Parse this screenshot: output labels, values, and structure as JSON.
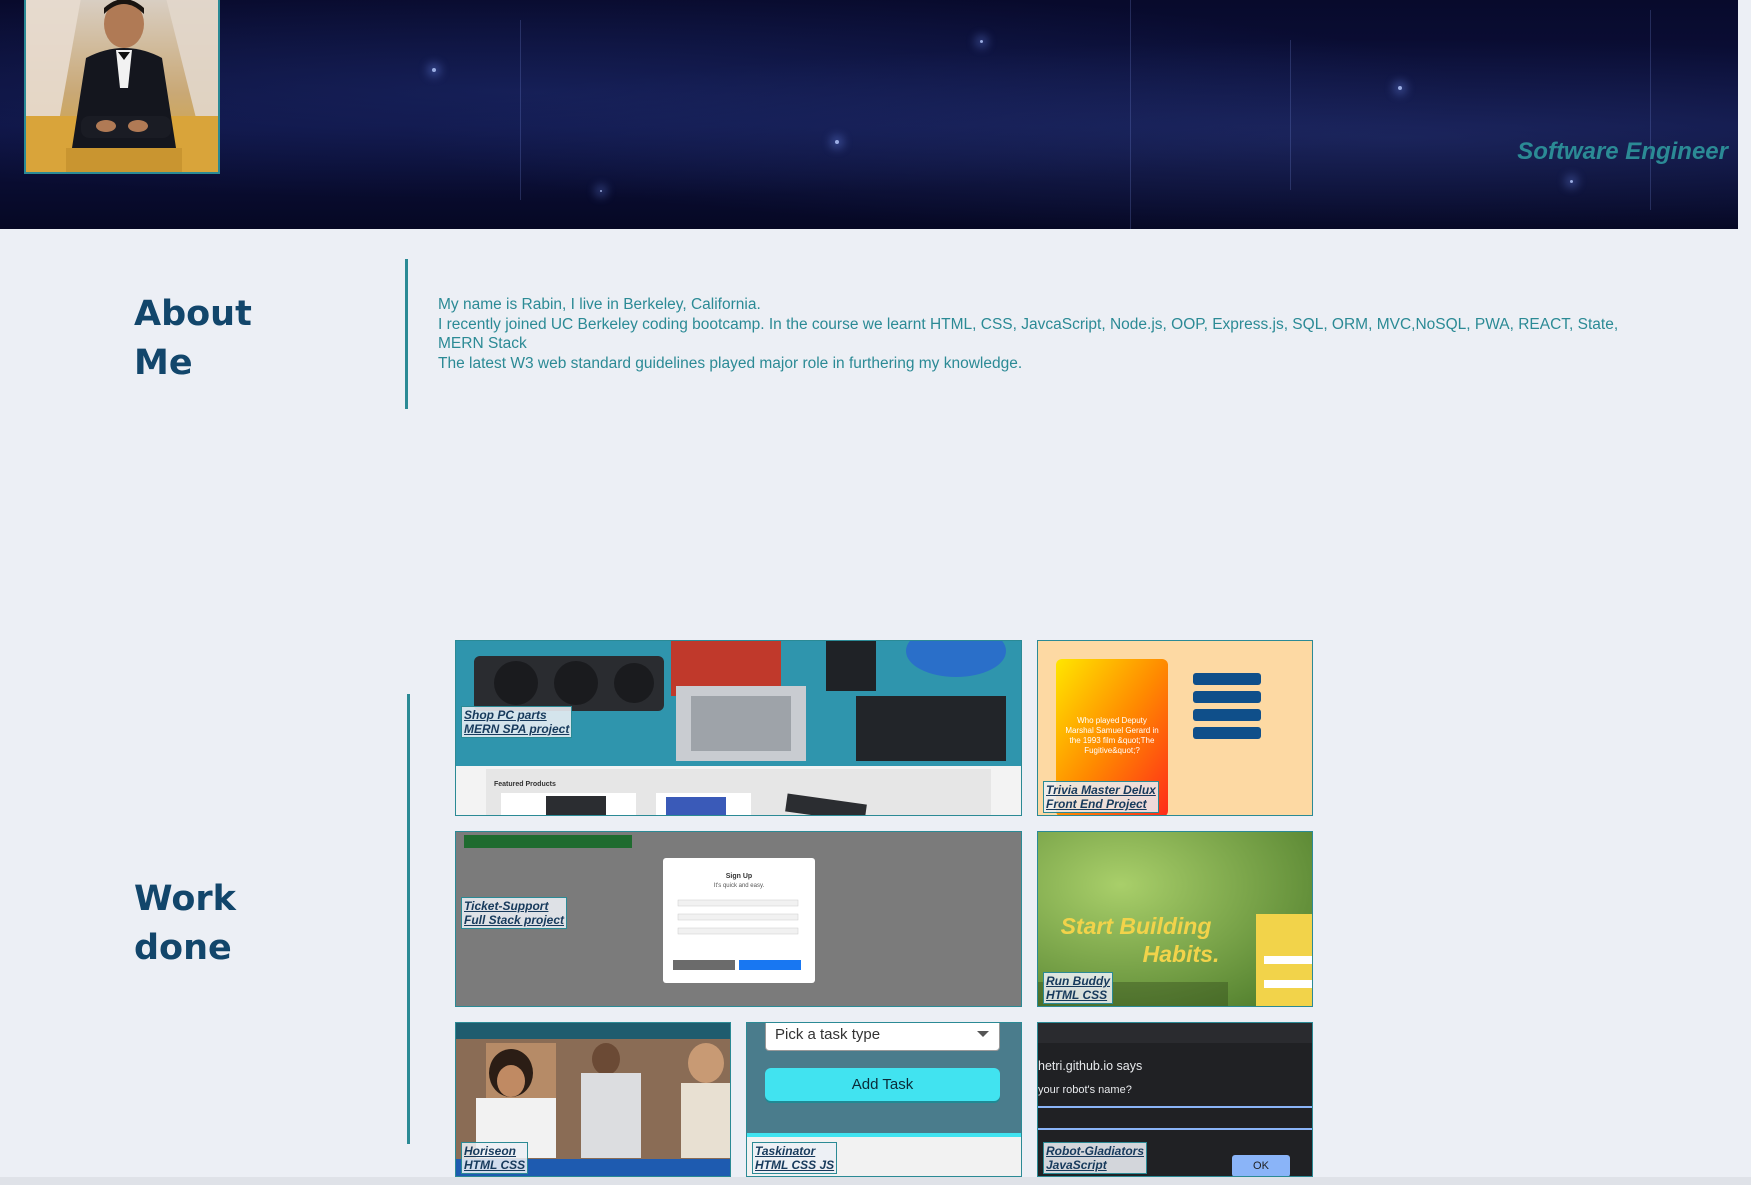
{
  "header": {
    "role": "Software Engineer",
    "photo_icon": "profile-photo"
  },
  "about": {
    "heading_line1": "About",
    "heading_line2": "Me",
    "paragraphs": [
      "My name is Rabin, I live in Berkeley, California.",
      "I recently joined UC Berkeley coding bootcamp. In the course we learnt HTML, CSS, JavcaScript, Node.js, OOP, Express.js, SQL, ORM, MVC,NoSQL, PWA, REACT, State, MERN Stack",
      "The latest W3 web standard guidelines played major role in furthering my knowledge."
    ]
  },
  "work": {
    "heading_line1": "Work",
    "heading_line2": "done",
    "projects": [
      {
        "title": "Shop PC parts",
        "subtitle": "MERN SPA project",
        "thumb_text": "Featured Products"
      },
      {
        "title": "Trivia Master Delux",
        "subtitle": "Front End Project",
        "thumb_text": "Who played Deputy Marshal Samuel Gerard in the 1993 film &quot;The Fugitive&quot;?"
      },
      {
        "title": "Ticket-Support",
        "subtitle": "Full Stack project",
        "thumb_text": "Sign Up"
      },
      {
        "title": "Run Buddy",
        "subtitle": "HTML CSS",
        "thumb_text": "Start Building Habits."
      },
      {
        "title": "Horiseon",
        "subtitle": "HTML CSS",
        "thumb_text": ""
      },
      {
        "title": "Taskinator",
        "subtitle": "HTML CSS JS",
        "thumb_text": "Pick a task type",
        "thumb_button": "Add Task"
      },
      {
        "title": "Robot-Gladiators",
        "subtitle": "JavaScript",
        "thumb_text": "hetri.github.io says",
        "thumb_prompt": "your robot's name?",
        "thumb_button": "OK"
      }
    ]
  },
  "colors": {
    "accent": "#2b8a95",
    "heading": "#12466b",
    "page_bg": "#eceff5",
    "banner_bg": "#0a0e34"
  }
}
